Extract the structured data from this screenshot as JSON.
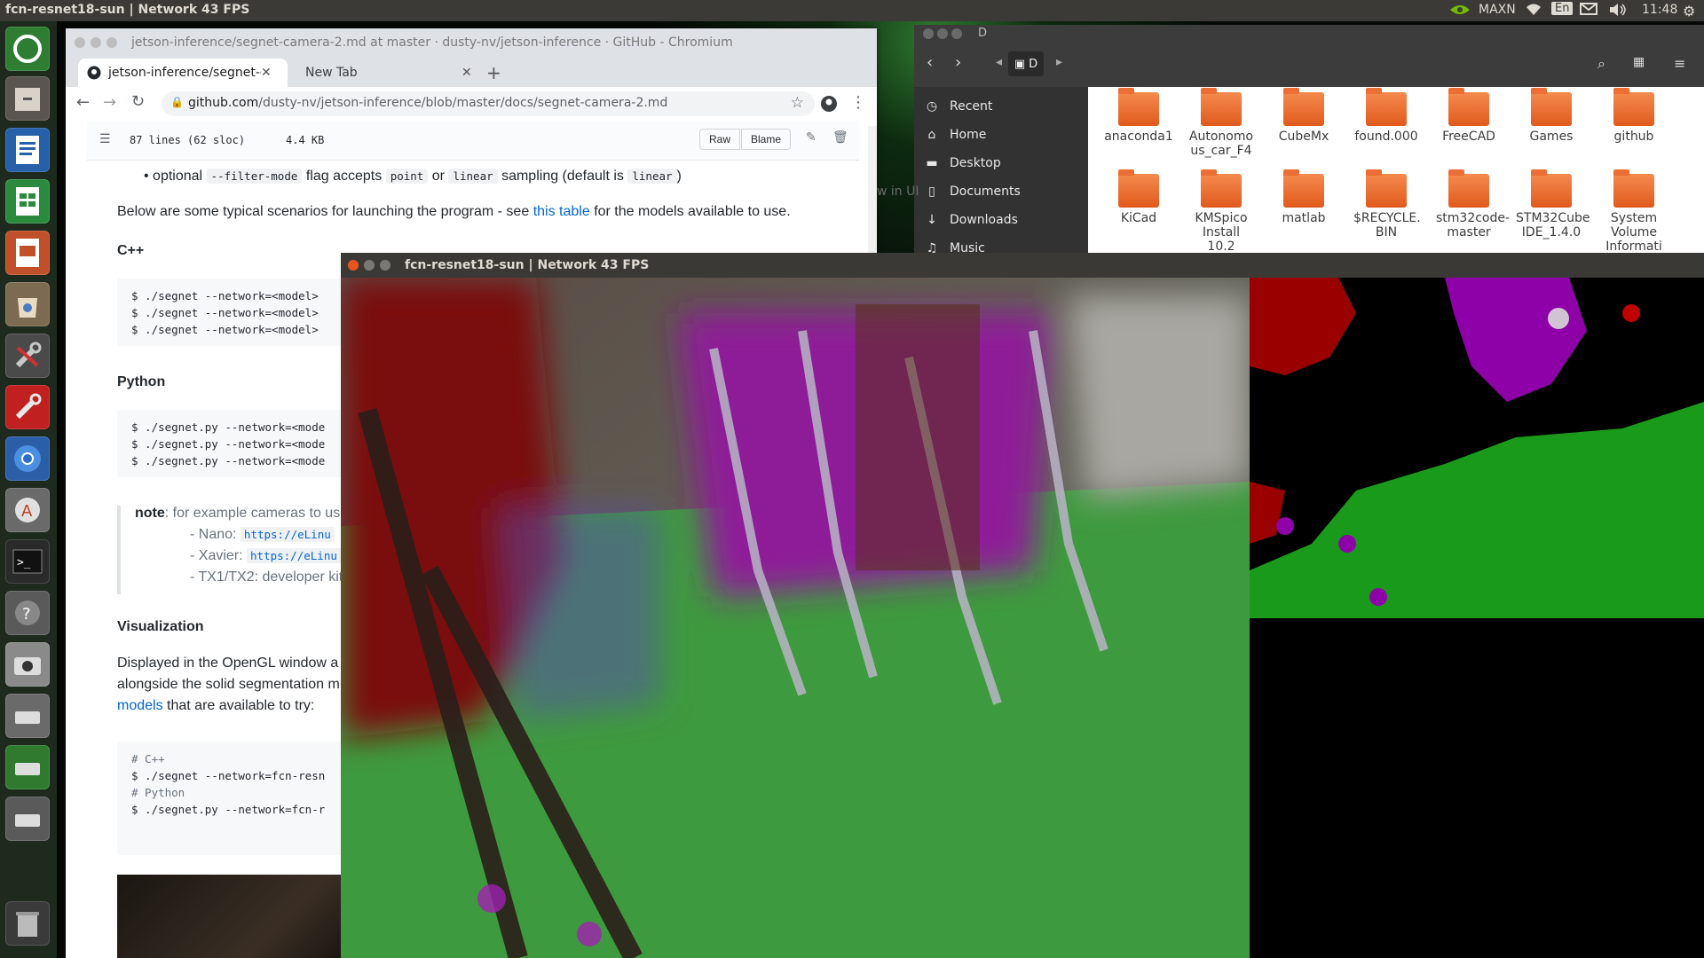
{
  "top_panel": {
    "active_title": "fcn-resnet18-sun | Network 43 FPS",
    "power_mode": "MAXN",
    "keyboard_layout": "En",
    "clock": "11:48",
    "icons": [
      "nvidia-icon",
      "wifi-icon",
      "keyboard-icon",
      "mail-icon",
      "volume-icon",
      "settings-gear-icon"
    ]
  },
  "launcher": {
    "items": [
      "ubuntu-dash-icon",
      "files-cabinet-icon",
      "writer-icon",
      "calc-icon",
      "impress-icon",
      "software-center-icon",
      "settings-icon",
      "settings-alt-icon",
      "chromium-icon",
      "updater-icon",
      "terminal-icon",
      "help-icon",
      "camera-icon",
      "drive-icon",
      "drive-alt-icon",
      "drive-alt2-icon",
      "trash-icon"
    ]
  },
  "chrome": {
    "window_title": "jetson-inference/segnet-camera-2.md at master · dusty-nv/jetson-inference · GitHub - Chromium",
    "tabs": [
      {
        "label": "jetson-inference/segnet-c",
        "active": true
      },
      {
        "label": "New Tab",
        "active": false
      }
    ],
    "url_host": "github.com",
    "url_path": "/dusty-nv/jetson-inference/blob/master/docs/segnet-camera-2.md",
    "file_info": {
      "lines": "87 lines (62 sloc)",
      "size": "4.4 KB",
      "raw": "Raw",
      "blame": "Blame"
    },
    "content": {
      "bullet_prefix": "optional",
      "bullet_code1": "--filter-mode",
      "bullet_mid1": "flag accepts",
      "bullet_code2": "point",
      "bullet_mid2": "or",
      "bullet_code3": "linear",
      "bullet_mid3": "sampling (default is",
      "bullet_code4": "linear",
      "bullet_end": ")",
      "intro_text": "Below are some typical scenarios for launching the program - see",
      "intro_link": "this table",
      "intro_tail": "for the models available to use.",
      "cpp_heading": "C++",
      "cpp_lines": [
        "$ ./segnet --network=<model>",
        "$ ./segnet --network=<model>",
        "$ ./segnet --network=<model>"
      ],
      "py_heading": "Python",
      "py_lines": [
        "$ ./segnet.py --network=<mode",
        "$ ./segnet.py --network=<mode",
        "$ ./segnet.py --network=<mode"
      ],
      "note_label": "note",
      "note_text": ": for example cameras to us",
      "note_nano_label": "- Nano:",
      "note_nano_code": "https://eLinu",
      "note_xavier_label": "- Xavier:",
      "note_xavier_code": "https://eLinu",
      "note_tx": "- TX1/TX2: developer kit",
      "vis_heading": "Visualization",
      "vis_line1": "Displayed in the OpenGL window a",
      "vis_line2": "alongside the solid segmentation m",
      "vis_link": "models",
      "vis_line3_tail": "that are available to try:",
      "example_lines": [
        "# C++",
        "$ ./segnet --network=fcn-resn",
        "",
        "# Python",
        "$ ./segnet.py --network=fcn-r"
      ]
    }
  },
  "files": {
    "window_title": "D",
    "path_label": "D",
    "sidebar": [
      "Recent",
      "Home",
      "Desktop",
      "Documents",
      "Downloads",
      "Music"
    ],
    "sidebar_icons": [
      "clock-icon",
      "home-icon",
      "folder-icon",
      "document-icon",
      "download-icon",
      "music-icon"
    ],
    "folders_row1": [
      "anaconda1",
      "Autonomo us_car_F4",
      "CubeMx",
      "found.000",
      "FreeCAD",
      "Games",
      "github"
    ],
    "folders_row2": [
      "KiCad",
      "KMSpico Install 10.2",
      "matlab",
      "$RECYCLE. BIN",
      "stm32code- master",
      "STM32Cube IDE_1.4.0",
      "System Volume Informati"
    ],
    "behind_text": "w in UI"
  },
  "gl_window": {
    "title": "fcn-resnet18-sun | Network 43 FPS"
  },
  "colors": {
    "panel": "#3b3a36",
    "launcher": "#1d2a1d",
    "folder_orange": "#e8652a",
    "link": "#0366d6",
    "seg_green": "#1a9a1a",
    "seg_purple": "#8a00a0",
    "seg_red": "#a00000"
  }
}
